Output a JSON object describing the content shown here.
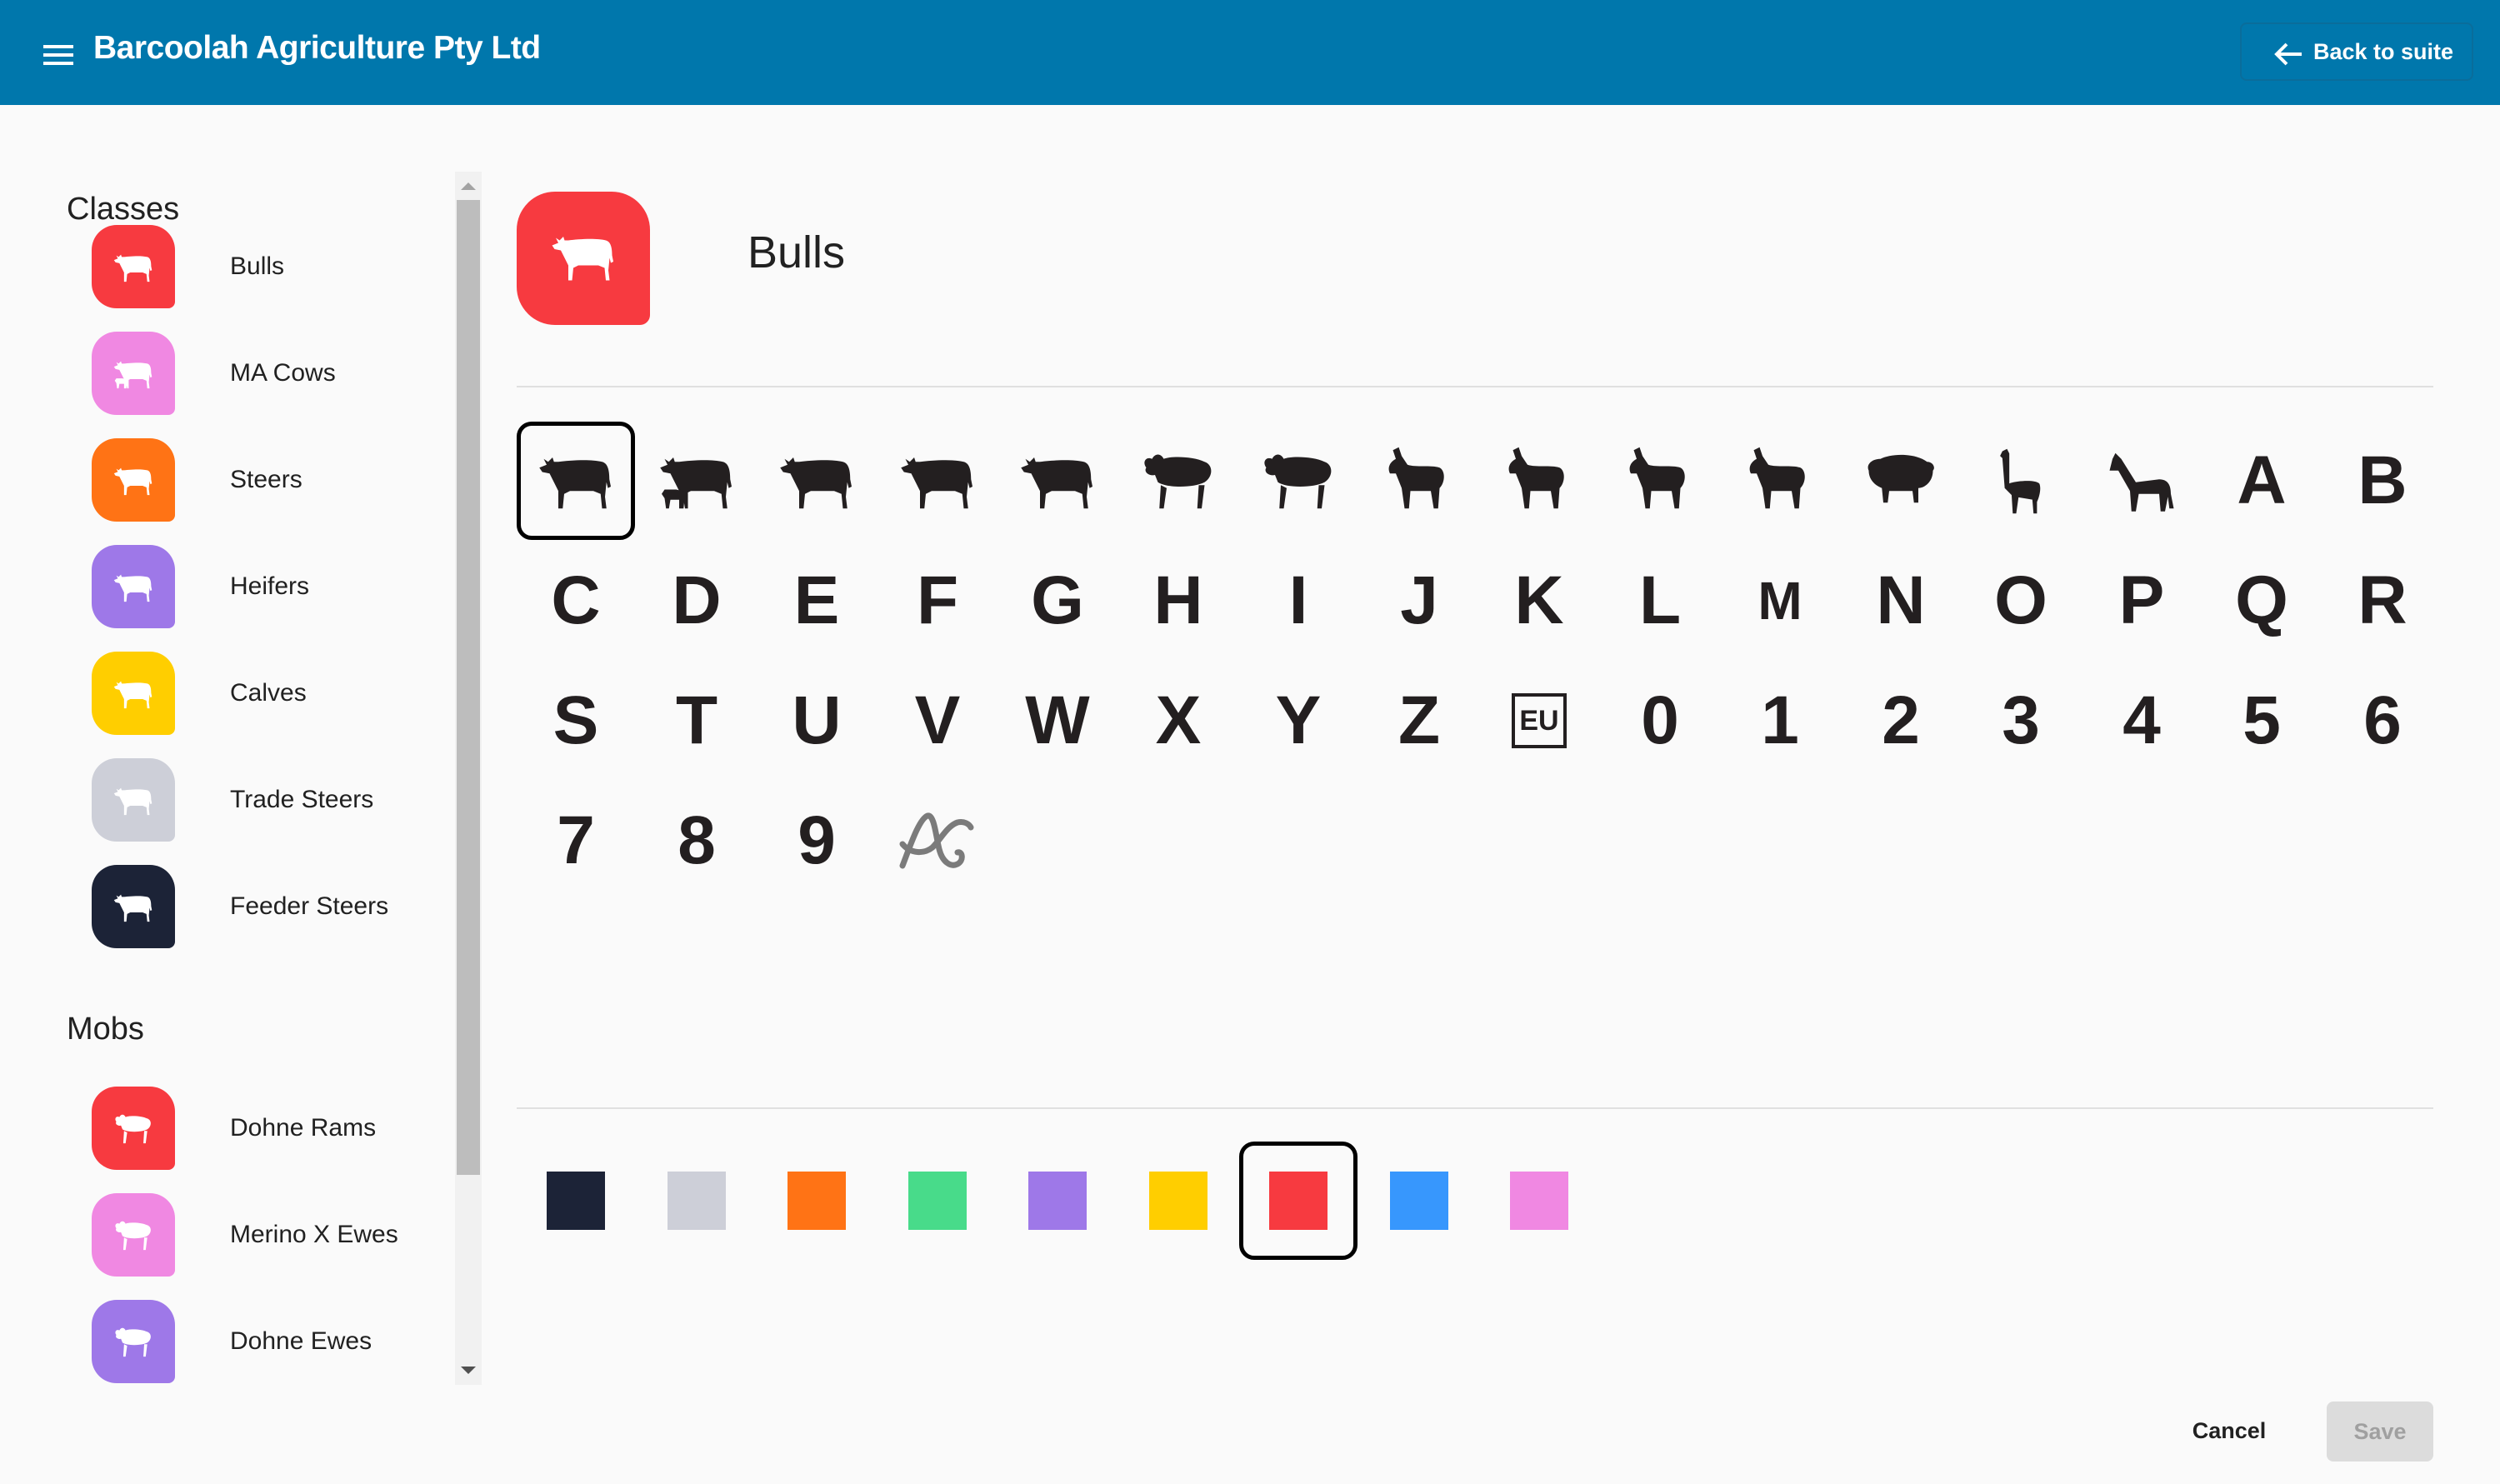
{
  "header": {
    "title": "Barcoolah Agriculture Pty Ltd",
    "back_label": "Back to suite",
    "bg_color": "#0077ac"
  },
  "sidebar": {
    "classes_title": "Classes",
    "classes": [
      {
        "label": "Bulls",
        "color": "#f73a40",
        "animal": "bull"
      },
      {
        "label": "MA Cows",
        "color": "#f088e2",
        "animal": "cow-calf"
      },
      {
        "label": "Steers",
        "color": "#ff7315",
        "animal": "steer"
      },
      {
        "label": "Heifers",
        "color": "#9e78e8",
        "animal": "heifer"
      },
      {
        "label": "Calves",
        "color": "#ffce00",
        "animal": "calf"
      },
      {
        "label": "Trade Steers",
        "color": "#cdcfd8",
        "animal": "steer"
      },
      {
        "label": "Feeder Steers",
        "color": "#1c2337",
        "animal": "steer"
      }
    ],
    "mobs_title": "Mobs",
    "mobs": [
      {
        "label": "Dohne Rams",
        "color": "#f73a40",
        "animal": "ram"
      },
      {
        "label": "Merino X Ewes",
        "color": "#f088e2",
        "animal": "ewe"
      },
      {
        "label": "Dohne Ewes",
        "color": "#9e78e8",
        "animal": "ewe"
      }
    ]
  },
  "editor": {
    "selected_name": "Bulls",
    "selected_color": "#f73a40",
    "selected_icon_index": 0,
    "icons": [
      {
        "type": "animal",
        "name": "bull-icon"
      },
      {
        "type": "animal",
        "name": "cow-calf-icon"
      },
      {
        "type": "animal",
        "name": "cow-icon"
      },
      {
        "type": "animal",
        "name": "steer-icon"
      },
      {
        "type": "animal",
        "name": "calf-icon"
      },
      {
        "type": "animal",
        "name": "ram-icon"
      },
      {
        "type": "animal",
        "name": "ewe-icon"
      },
      {
        "type": "animal",
        "name": "goat-icon"
      },
      {
        "type": "animal",
        "name": "billy-goat-icon"
      },
      {
        "type": "animal",
        "name": "nanny-goat-icon"
      },
      {
        "type": "animal",
        "name": "antelope-icon"
      },
      {
        "type": "animal",
        "name": "pig-icon"
      },
      {
        "type": "animal",
        "name": "alpaca-icon"
      },
      {
        "type": "animal",
        "name": "horse-icon"
      },
      {
        "type": "text",
        "value": "A"
      },
      {
        "type": "text",
        "value": "B"
      },
      {
        "type": "text",
        "value": "C"
      },
      {
        "type": "text",
        "value": "D"
      },
      {
        "type": "text",
        "value": "E"
      },
      {
        "type": "text",
        "value": "F"
      },
      {
        "type": "text",
        "value": "G"
      },
      {
        "type": "text",
        "value": "H"
      },
      {
        "type": "text",
        "value": "I"
      },
      {
        "type": "text",
        "value": "J"
      },
      {
        "type": "text",
        "value": "K"
      },
      {
        "type": "text",
        "value": "L"
      },
      {
        "type": "text",
        "value": "M"
      },
      {
        "type": "text",
        "value": "N"
      },
      {
        "type": "text",
        "value": "O"
      },
      {
        "type": "text",
        "value": "P"
      },
      {
        "type": "text",
        "value": "Q"
      },
      {
        "type": "text",
        "value": "R"
      },
      {
        "type": "text",
        "value": "S"
      },
      {
        "type": "text",
        "value": "T"
      },
      {
        "type": "text",
        "value": "U"
      },
      {
        "type": "text",
        "value": "V"
      },
      {
        "type": "text",
        "value": "W"
      },
      {
        "type": "text",
        "value": "X"
      },
      {
        "type": "text",
        "value": "Y"
      },
      {
        "type": "text",
        "value": "Z"
      },
      {
        "type": "eu",
        "value": "EU"
      },
      {
        "type": "text",
        "value": "0"
      },
      {
        "type": "text",
        "value": "1"
      },
      {
        "type": "text",
        "value": "2"
      },
      {
        "type": "text",
        "value": "3"
      },
      {
        "type": "text",
        "value": "4"
      },
      {
        "type": "text",
        "value": "5"
      },
      {
        "type": "text",
        "value": "6"
      },
      {
        "type": "text",
        "value": "7"
      },
      {
        "type": "text",
        "value": "8"
      },
      {
        "type": "text",
        "value": "9"
      },
      {
        "type": "brand",
        "name": "ac-logo-icon"
      }
    ],
    "colors": [
      "#1c2337",
      "#cdcfd8",
      "#ff7315",
      "#48db8a",
      "#9e78e8",
      "#ffce00",
      "#f73a40",
      "#3797fd",
      "#f088e2"
    ],
    "selected_color_index": 6
  },
  "actions": {
    "cancel_label": "Cancel",
    "save_label": "Save"
  }
}
